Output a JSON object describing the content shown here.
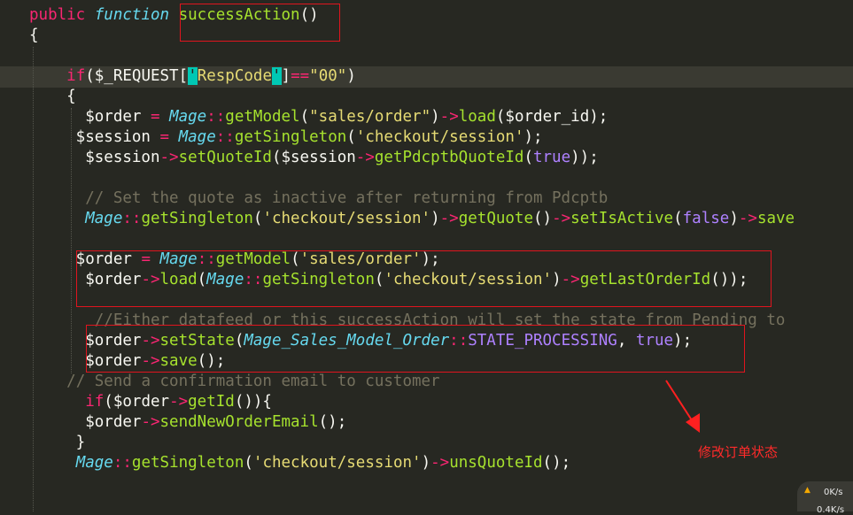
{
  "editor": {
    "lines": [
      [
        [
          "kw",
          "public"
        ],
        [
          "t",
          " "
        ],
        [
          "st",
          "function"
        ],
        [
          "t",
          " "
        ],
        [
          "fn",
          "successAction"
        ],
        [
          "t",
          "()"
        ]
      ],
      [
        [
          "t",
          "{"
        ]
      ],
      [],
      [
        [
          "t",
          "    "
        ],
        [
          "kw",
          "if"
        ],
        [
          "t",
          "($_REQUEST["
        ],
        [
          "q",
          "'"
        ],
        [
          "str",
          "RespCode"
        ],
        [
          "q",
          "'"
        ],
        [
          "t",
          "]"
        ],
        [
          "op",
          "=="
        ],
        [
          "str",
          "\"00\""
        ],
        [
          "t",
          ")"
        ]
      ],
      [
        [
          "t",
          "    {"
        ]
      ],
      [
        [
          "t",
          "      $order "
        ],
        [
          "op",
          "="
        ],
        [
          "t",
          " "
        ],
        [
          "st",
          "Mage"
        ],
        [
          "op",
          "::"
        ],
        [
          "fn",
          "getModel"
        ],
        [
          "t",
          "("
        ],
        [
          "str",
          "\"sales/order\""
        ],
        [
          "t",
          ")"
        ],
        [
          "op",
          "->"
        ],
        [
          "fn",
          "load"
        ],
        [
          "t",
          "($order_id);"
        ]
      ],
      [
        [
          "t",
          "     $session "
        ],
        [
          "op",
          "="
        ],
        [
          "t",
          " "
        ],
        [
          "st",
          "Mage"
        ],
        [
          "op",
          "::"
        ],
        [
          "fn",
          "getSingleton"
        ],
        [
          "t",
          "("
        ],
        [
          "str",
          "'checkout/session'"
        ],
        [
          "t",
          ");"
        ]
      ],
      [
        [
          "t",
          "      $session"
        ],
        [
          "op",
          "->"
        ],
        [
          "fn",
          "setQuoteId"
        ],
        [
          "t",
          "($session"
        ],
        [
          "op",
          "->"
        ],
        [
          "fn",
          "getPdcptbQuoteId"
        ],
        [
          "t",
          "("
        ],
        [
          "num",
          "true"
        ],
        [
          "t",
          "));"
        ]
      ],
      [],
      [
        [
          "t",
          "      "
        ],
        [
          "cm",
          "// Set the quote as inactive after returning from Pdcptb"
        ]
      ],
      [
        [
          "t",
          "      "
        ],
        [
          "st",
          "Mage"
        ],
        [
          "op",
          "::"
        ],
        [
          "fn",
          "getSingleton"
        ],
        [
          "t",
          "("
        ],
        [
          "str",
          "'checkout/session'"
        ],
        [
          "t",
          ")"
        ],
        [
          "op",
          "->"
        ],
        [
          "fn",
          "getQuote"
        ],
        [
          "t",
          "()"
        ],
        [
          "op",
          "->"
        ],
        [
          "fn",
          "setIsActive"
        ],
        [
          "t",
          "("
        ],
        [
          "num",
          "false"
        ],
        [
          "t",
          ")"
        ],
        [
          "op",
          "->"
        ],
        [
          "fn",
          "save"
        ]
      ],
      [],
      [
        [
          "t",
          "     $order "
        ],
        [
          "op",
          "="
        ],
        [
          "t",
          " "
        ],
        [
          "st",
          "Mage"
        ],
        [
          "op",
          "::"
        ],
        [
          "fn",
          "getModel"
        ],
        [
          "t",
          "("
        ],
        [
          "str",
          "'sales/order'"
        ],
        [
          "t",
          ");"
        ]
      ],
      [
        [
          "t",
          "      $order"
        ],
        [
          "op",
          "->"
        ],
        [
          "fn",
          "load"
        ],
        [
          "t",
          "("
        ],
        [
          "st",
          "Mage"
        ],
        [
          "op",
          "::"
        ],
        [
          "fn",
          "getSingleton"
        ],
        [
          "t",
          "("
        ],
        [
          "str",
          "'checkout/session'"
        ],
        [
          "t",
          ")"
        ],
        [
          "op",
          "->"
        ],
        [
          "fn",
          "getLastOrderId"
        ],
        [
          "t",
          "());"
        ]
      ],
      [],
      [
        [
          "t",
          "       "
        ],
        [
          "cm",
          "//Either datafeed or this successAction will set the state from Pending to"
        ]
      ],
      [
        [
          "t",
          "      $order"
        ],
        [
          "op",
          "->"
        ],
        [
          "fn",
          "setState"
        ],
        [
          "t",
          "("
        ],
        [
          "st",
          "Mage_Sales_Model_Order"
        ],
        [
          "op",
          "::"
        ],
        [
          "num",
          "STATE_PROCESSING"
        ],
        [
          "t",
          ", "
        ],
        [
          "num",
          "true"
        ],
        [
          "t",
          ");"
        ]
      ],
      [
        [
          "t",
          "      $order"
        ],
        [
          "op",
          "->"
        ],
        [
          "fn",
          "save"
        ],
        [
          "t",
          "();"
        ]
      ],
      [
        [
          "t",
          "    "
        ],
        [
          "cm",
          "// Send a confirmation email to customer"
        ]
      ],
      [
        [
          "t",
          "      "
        ],
        [
          "kw",
          "if"
        ],
        [
          "t",
          "($order"
        ],
        [
          "op",
          "->"
        ],
        [
          "fn",
          "getId"
        ],
        [
          "t",
          "()){"
        ]
      ],
      [
        [
          "t",
          "      $order"
        ],
        [
          "op",
          "->"
        ],
        [
          "fn",
          "sendNewOrderEmail"
        ],
        [
          "t",
          "();"
        ]
      ],
      [
        [
          "t",
          "     }"
        ]
      ],
      [
        [
          "t",
          "     "
        ],
        [
          "st",
          "Mage"
        ],
        [
          "op",
          "::"
        ],
        [
          "fn",
          "getSingleton"
        ],
        [
          "t",
          "("
        ],
        [
          "str",
          "'checkout/session'"
        ],
        [
          "t",
          ")"
        ],
        [
          "op",
          "->"
        ],
        [
          "fn",
          "unsQuoteId"
        ],
        [
          "t",
          "();"
        ]
      ]
    ]
  },
  "annotation": {
    "text": "修改订单状态"
  },
  "net_widget": {
    "icon": "up-arrow-icon",
    "line1": "0K/s",
    "line2": "0.4K/s"
  }
}
